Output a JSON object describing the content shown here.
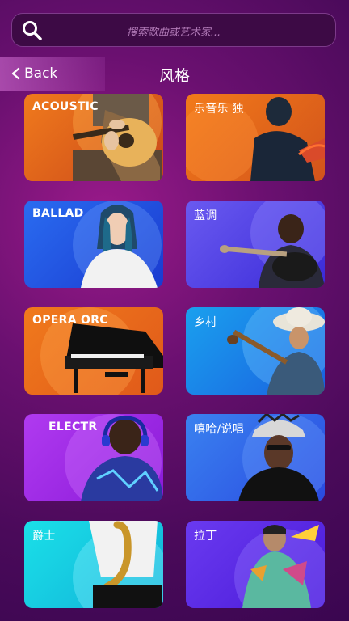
{
  "search": {
    "placeholder": "搜索歌曲或艺术家...",
    "icon": "search-icon"
  },
  "header": {
    "back_label": "Back",
    "title": "风格"
  },
  "genres": [
    {
      "label": "ACOUSTIC"
    },
    {
      "label": "乐音乐 独"
    },
    {
      "label": "BALLAD"
    },
    {
      "label": "蓝调"
    },
    {
      "label": "OPERA ORC"
    },
    {
      "label": "乡村"
    },
    {
      "label": "ELECTR"
    },
    {
      "label": "嘻哈/说唱"
    },
    {
      "label": "爵士"
    },
    {
      "label": "拉丁"
    }
  ]
}
